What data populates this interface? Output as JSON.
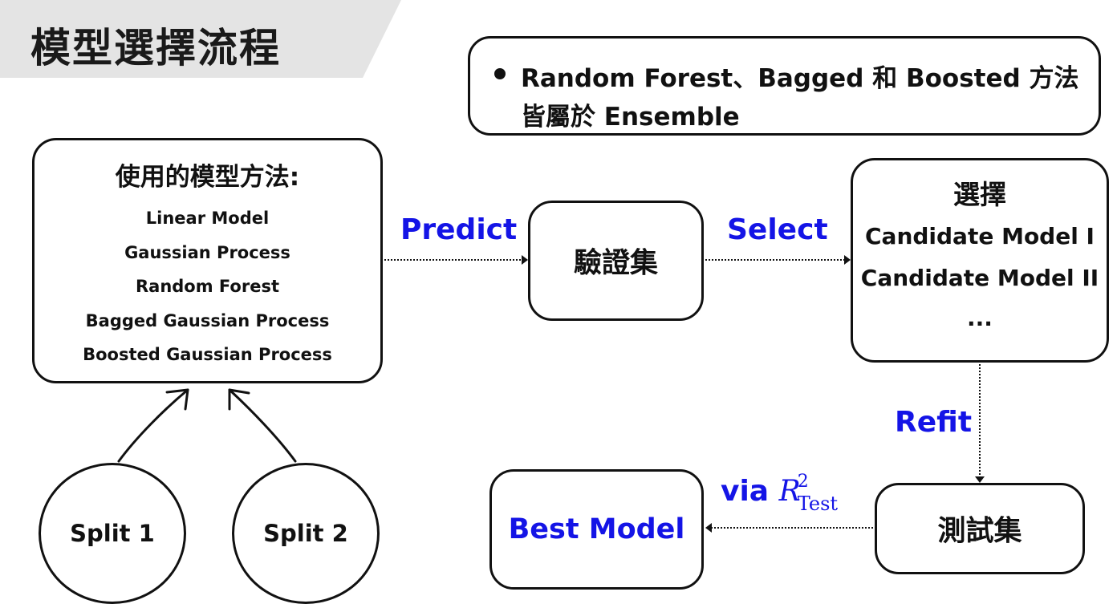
{
  "header": {
    "title": "模型選擇流程"
  },
  "note": {
    "line1": "Random Forest、Bagged 和  Boosted 方法",
    "line2": "皆屬於 Ensemble"
  },
  "methods": {
    "title": "使用的模型方法:",
    "items": [
      "Linear Model",
      "Gaussian Process",
      "Random Forest",
      "Bagged Gaussian Process",
      "Boosted Gaussian Process"
    ]
  },
  "splits": {
    "split1": "Split 1",
    "split2": "Split 2"
  },
  "validation": {
    "label": "驗證集"
  },
  "selection": {
    "title": "選擇",
    "items": [
      "Candidate Model I",
      "Candidate Model II",
      "..."
    ]
  },
  "test": {
    "label": "測試集"
  },
  "best": {
    "label": "Best Model"
  },
  "edges": {
    "predict": "Predict",
    "select": "Select",
    "refit": "Refit",
    "via": "via",
    "metric_symbol": "R",
    "metric_superscript": "2",
    "metric_subscript": "Test"
  },
  "colors": {
    "accent": "#1414e6",
    "title_bar": "#e4e4e4",
    "stroke": "#111111"
  }
}
